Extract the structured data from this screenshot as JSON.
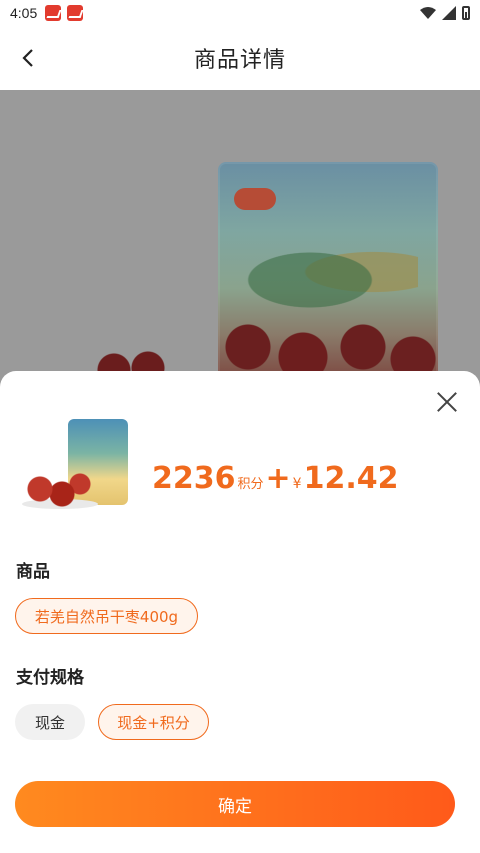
{
  "status_bar": {
    "time": "4:05"
  },
  "header": {
    "title": "商品详情"
  },
  "sheet": {
    "price": {
      "points": "2236",
      "points_unit": "积分",
      "plus": "+",
      "currency": "¥",
      "cash": "12.42"
    },
    "product_section": {
      "label": "商品",
      "options": [
        {
          "label": "若羌自然吊干枣400g",
          "selected": true
        }
      ]
    },
    "payment_section": {
      "label": "支付规格",
      "options": [
        {
          "label": "现金",
          "selected": false
        },
        {
          "label": "现金+积分",
          "selected": true
        }
      ]
    },
    "confirm_label": "确定"
  },
  "colors": {
    "accent": "#f06a1d",
    "accent_light": "#fff4ec",
    "overlay": "#9a9a9a"
  },
  "icons": {
    "back": "chevron-left-icon",
    "close": "close-icon"
  }
}
